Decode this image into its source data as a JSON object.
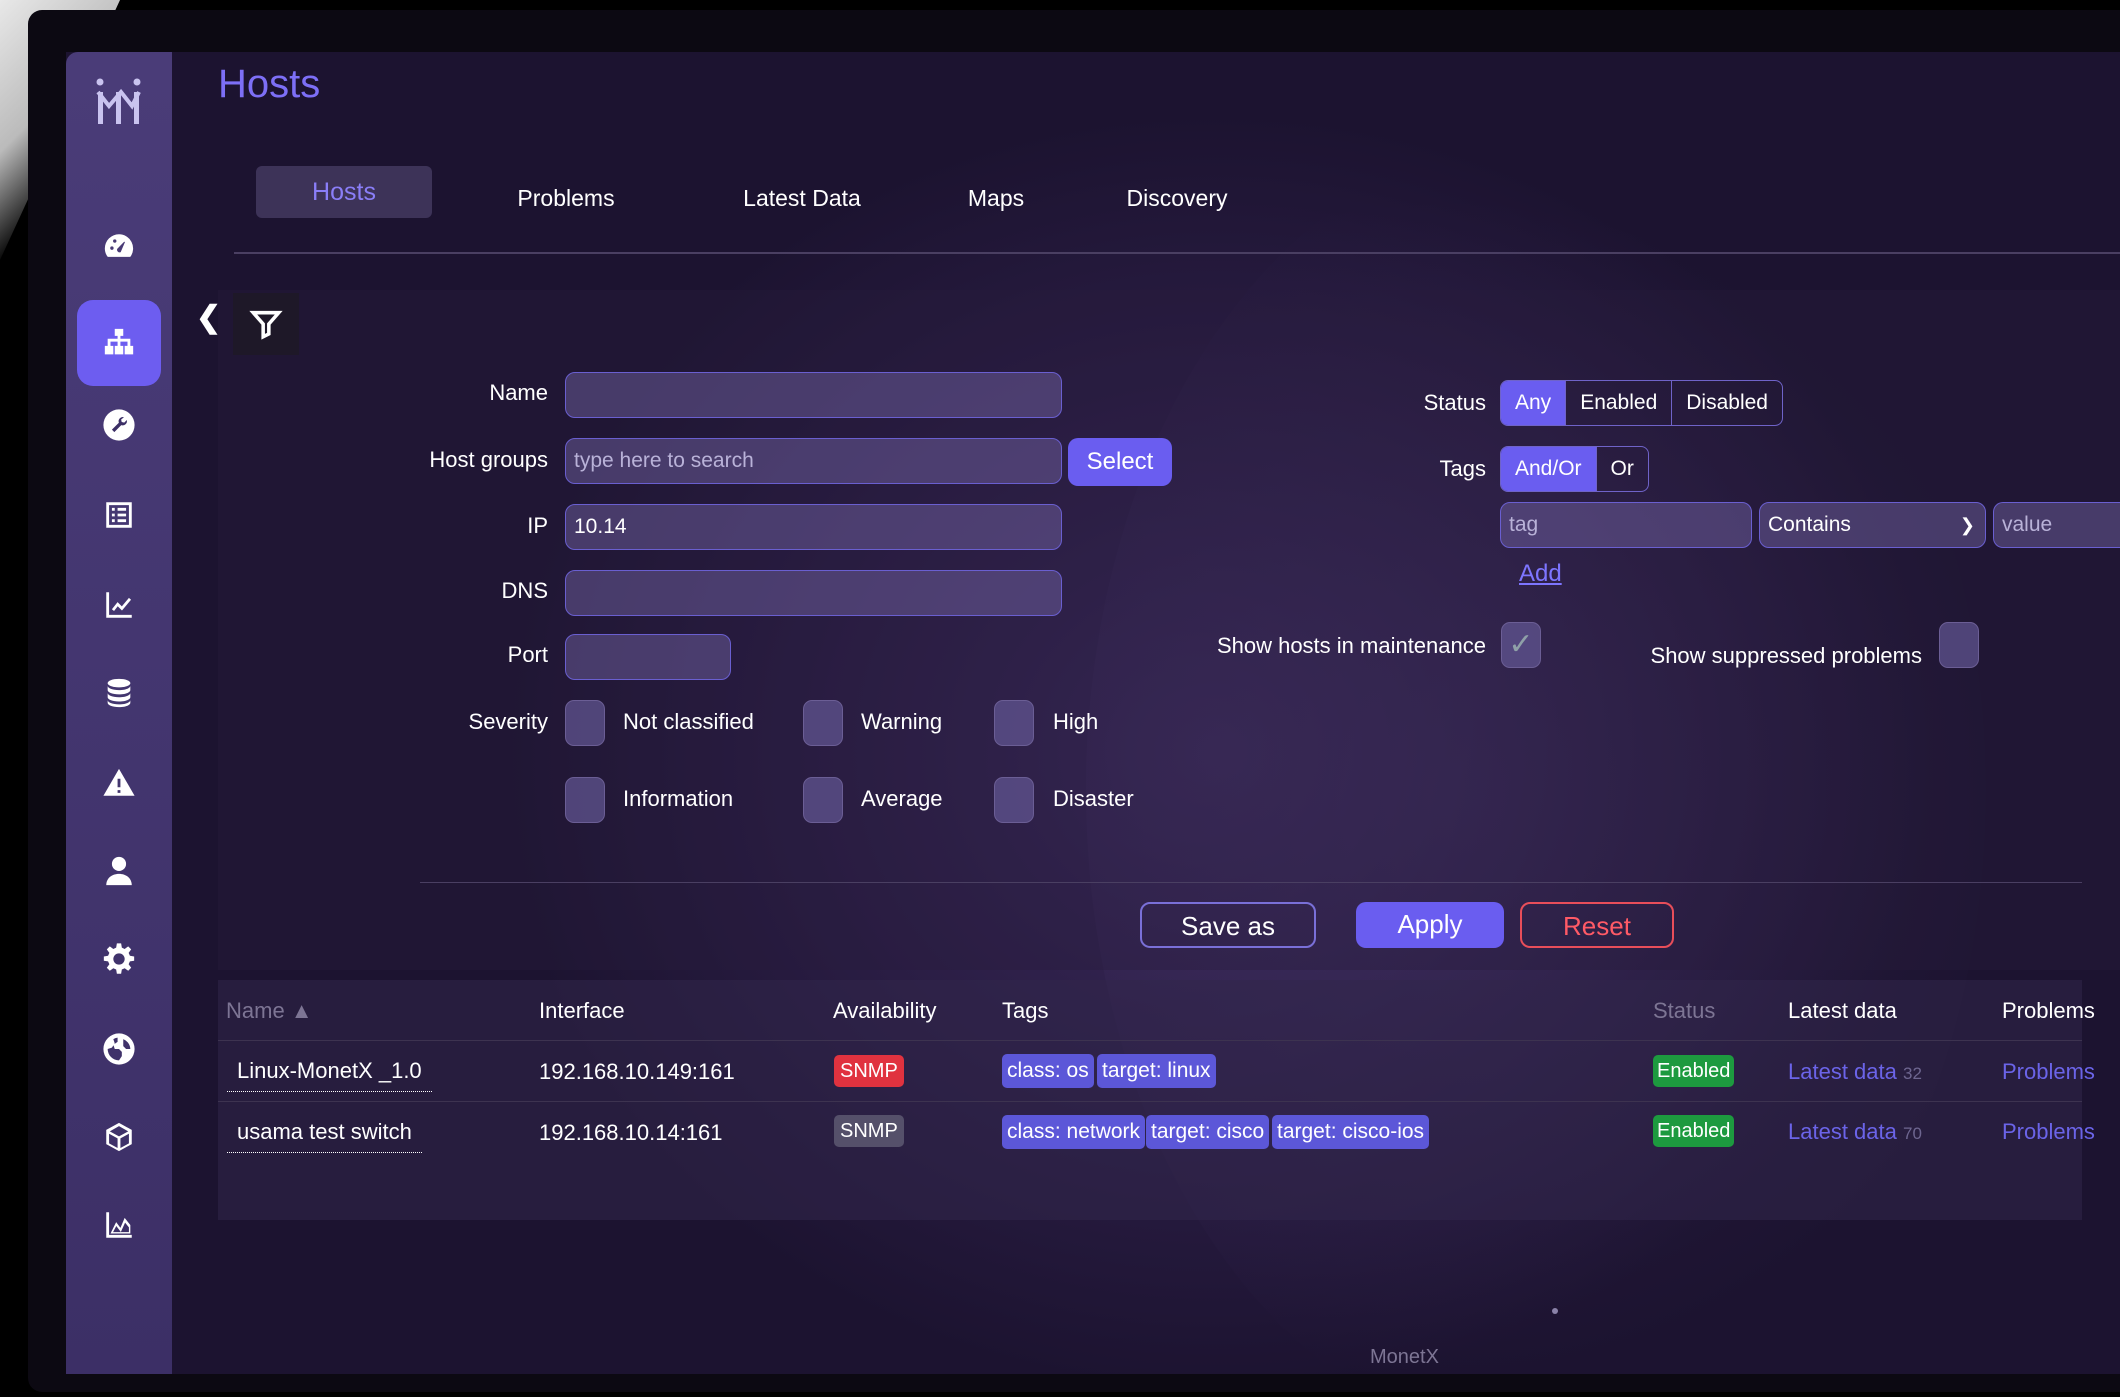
{
  "app": {
    "title": "Hosts",
    "footer": "MonetX"
  },
  "tabs": [
    "Hosts",
    "Problems",
    "Latest Data",
    "Maps",
    "Discovery"
  ],
  "sidebar": {
    "logo": "MonetX",
    "items": [
      "dashboard",
      "hosts",
      "configuration",
      "reports",
      "graphs",
      "database",
      "alerts",
      "users",
      "settings",
      "network",
      "inventory",
      "monitoring"
    ]
  },
  "filter": {
    "name_label": "Name",
    "name_value": "",
    "host_groups_label": "Host groups",
    "host_groups_placeholder": "type here to search",
    "select_label": "Select",
    "ip_label": "IP",
    "ip_value": "10.14",
    "dns_label": "DNS",
    "dns_value": "",
    "port_label": "Port",
    "port_value": "",
    "severity_label": "Severity",
    "severities": [
      "Not classified",
      "Warning",
      "High",
      "Information",
      "Average",
      "Disaster"
    ],
    "status_label": "Status",
    "status_options": [
      "Any",
      "Enabled",
      "Disabled"
    ],
    "status_selected": "Any",
    "tags_label": "Tags",
    "tags_options": [
      "And/Or",
      "Or"
    ],
    "tags_selected": "And/Or",
    "tag_placeholder": "tag",
    "tag_operator": "Contains",
    "value_placeholder": "value",
    "add_label": "Add",
    "maintenance_label": "Show hosts in maintenance",
    "maintenance_checked": true,
    "suppressed_label": "Show suppressed problems",
    "suppressed_checked": false
  },
  "actions": {
    "save_as": "Save as",
    "apply": "Apply",
    "reset": "Reset"
  },
  "table": {
    "headers": {
      "name": "Name ▲",
      "interface": "Interface",
      "availability": "Availability",
      "tags": "Tags",
      "status": "Status",
      "latest_data": "Latest data",
      "problems": "Problems"
    },
    "rows": [
      {
        "name": "Linux-MonetX _1.0",
        "interface": "192.168.10.149:161",
        "availability": "SNMP",
        "tags": [
          "class: os",
          "target: linux"
        ],
        "status": "Enabled",
        "latest_data": "Latest data",
        "latest_count": "32",
        "problems": "Problems"
      },
      {
        "name": "usama test switch",
        "interface": "192.168.10.14:161",
        "availability": "SNMP",
        "tags": [
          "class: network",
          "target: cisco",
          "target: cisco-ios"
        ],
        "status": "Enabled",
        "latest_data": "Latest data",
        "latest_count": "70",
        "problems": "Problems"
      }
    ]
  },
  "colors": {
    "accent": "#6a5df0",
    "title": "#7d6ff6",
    "danger": "#e0323f",
    "success": "#1d9a3f"
  }
}
